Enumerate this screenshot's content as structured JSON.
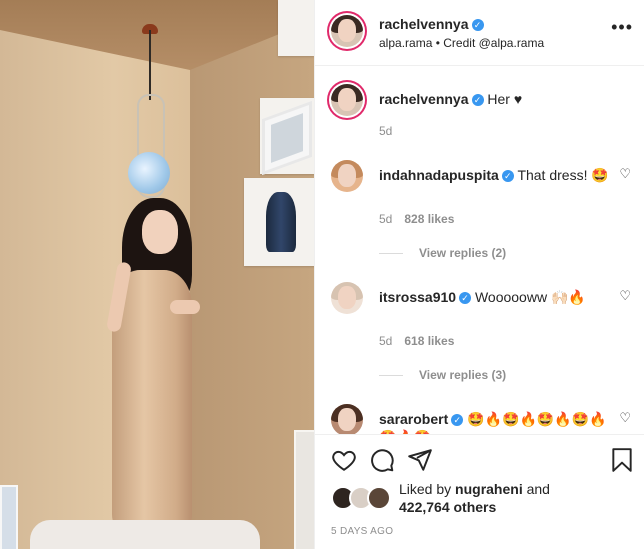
{
  "post": {
    "author": {
      "username": "rachelvennya",
      "location": "alpa.rama",
      "credit": "Credit @alpa.rama",
      "separator": "•"
    },
    "more_label": "•••",
    "caption": {
      "username": "rachelvennya",
      "text": "Her ♥",
      "time": "5d"
    },
    "comments": [
      {
        "username": "indahnadapuspita",
        "text": "That dress! 🤩",
        "time": "5d",
        "likes": "828 likes",
        "replies": "View replies (2)"
      },
      {
        "username": "itsrossa910",
        "text": "Woooooww 🙌🏻🔥",
        "time": "5d",
        "likes": "618 likes",
        "replies": "View replies (3)"
      },
      {
        "username": "sararobert",
        "text": "🤩🔥🤩🔥🤩🔥🤩🔥🤩🔥🤩",
        "time": "",
        "likes": "",
        "replies": ""
      }
    ],
    "likes": {
      "prefix": "Liked by",
      "user": "nugraheni",
      "and": "and",
      "count": "422,764 others"
    },
    "timestamp": "5 DAYS AGO"
  },
  "icons": {
    "like": "heart-icon",
    "comment": "comment-icon",
    "share": "share-icon",
    "save": "bookmark-icon",
    "comment_like": "heart-icon"
  },
  "colors": {
    "verified": "#3897f0",
    "text": "#262626",
    "muted": "#8e8e8e",
    "story_ring": "#e0296a"
  }
}
